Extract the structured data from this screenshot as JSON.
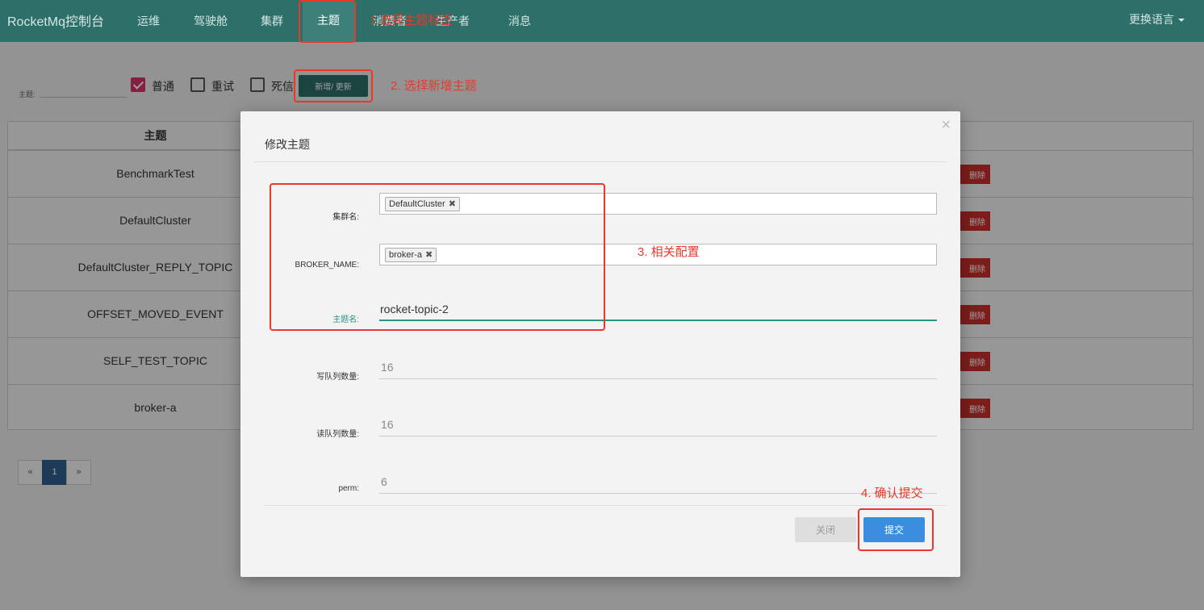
{
  "navbar": {
    "brand": "RocketMq控制台",
    "items": [
      {
        "label": "运维"
      },
      {
        "label": "驾驶舱"
      },
      {
        "label": "集群"
      },
      {
        "label": "主题"
      },
      {
        "label": "消费者"
      },
      {
        "label": "生产者"
      },
      {
        "label": "消息"
      }
    ],
    "active": "主题",
    "language": "更换语言"
  },
  "filter": {
    "topic_label": "主题:",
    "topic_value": "",
    "checkboxes": [
      {
        "label": "普通",
        "checked": true
      },
      {
        "label": "重试",
        "checked": false
      },
      {
        "label": "死信",
        "checked": false
      }
    ],
    "add_button": "新增/ 更新"
  },
  "table": {
    "header": "主题",
    "rows": [
      {
        "name": "BenchmarkTest",
        "delete": "删除"
      },
      {
        "name": "DefaultCluster",
        "delete": "删除"
      },
      {
        "name": "DefaultCluster_REPLY_TOPIC",
        "delete": "删除"
      },
      {
        "name": "OFFSET_MOVED_EVENT",
        "delete": "删除"
      },
      {
        "name": "SELF_TEST_TOPIC",
        "delete": "删除"
      },
      {
        "name": "broker-a",
        "delete": "删除"
      }
    ]
  },
  "pagination": {
    "prev": "«",
    "current": "1",
    "next": "»"
  },
  "modal": {
    "title": "修改主题",
    "close_icon": "×",
    "fields": {
      "cluster_label": "集群名:",
      "cluster_tag": "DefaultCluster",
      "broker_label": "BROKER_NAME:",
      "broker_tag": "broker-a",
      "topic_label": "主题名:",
      "topic_value": "rocket-topic-2",
      "write_label": "写队列数量:",
      "write_value": "16",
      "read_label": "读队列数量:",
      "read_value": "16",
      "perm_label": "perm:",
      "perm_value": "6"
    },
    "tag_remove": "✖",
    "close_button": "关闭",
    "submit_button": "提交"
  },
  "annotations": {
    "step1": "1.选择主题标签",
    "step2": "2. 选择新增主题",
    "step3": "3. 相关配置",
    "step4": "4. 确认提交",
    "color": "#e8392b"
  },
  "colors": {
    "navbar": "#2d6f69",
    "accent": "#2d8f85",
    "submit": "#3b8de0",
    "danger": "#c9302c",
    "checkbox": "#d5336b"
  }
}
